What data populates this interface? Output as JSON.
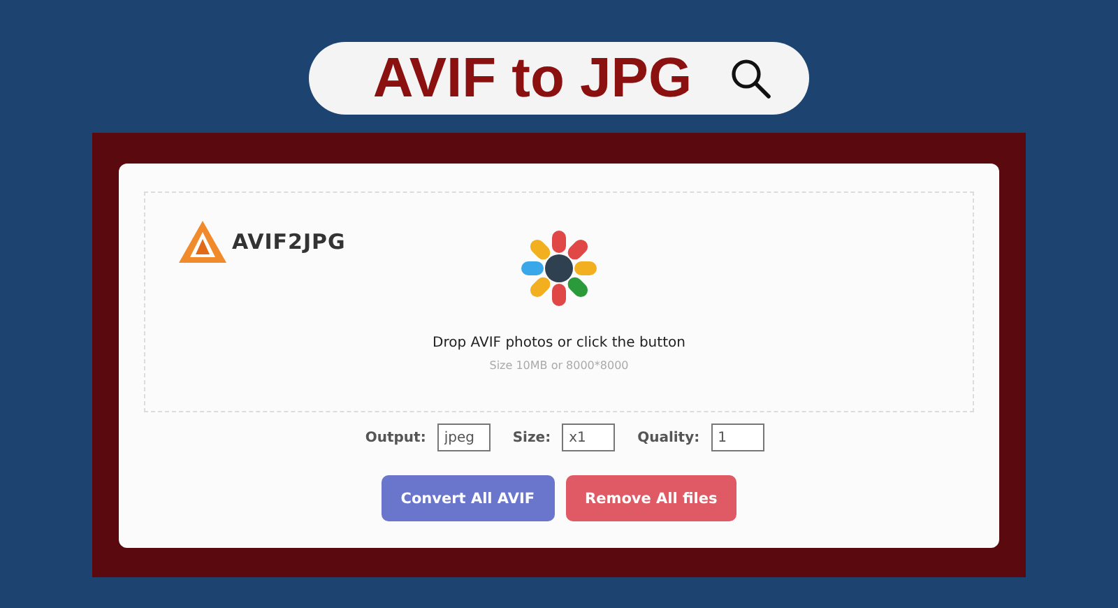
{
  "banner": {
    "title": "AVIF to JPG"
  },
  "app": {
    "logo": "AVIF2JPG",
    "drop_title": "Drop AVIF photos or click the button",
    "drop_hint": "Size 10MB or 8000*8000",
    "options": [
      {
        "label": "Output:",
        "value": "jpeg"
      },
      {
        "label": "Size:",
        "value": "x1"
      },
      {
        "label": "Quality:",
        "value": "1"
      }
    ],
    "buttons": [
      {
        "label": "Convert All AVIF",
        "kind": "primary"
      },
      {
        "label": "Remove All files",
        "kind": "danger"
      }
    ]
  }
}
